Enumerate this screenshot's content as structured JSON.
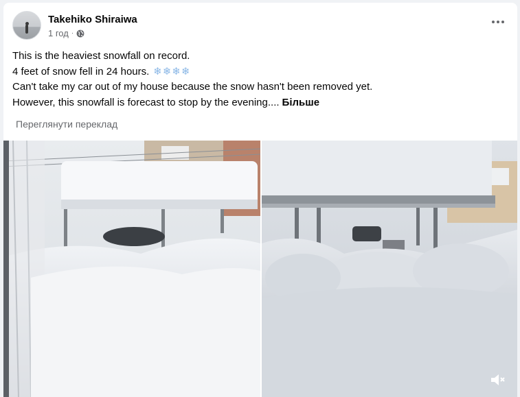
{
  "post": {
    "author": "Takehiko Shiraiwa",
    "time": "1 год",
    "time_sep": "·",
    "privacy_icon": "globe-icon",
    "more_icon": "more-options-icon",
    "lines": [
      "This is the heaviest snowfall on record.",
      "4 feet of snow fell in 24 hours.",
      "Can't take my car out of my house because the snow hasn't been removed yet.",
      "However, this snowfall is forecast to stop by the evening...."
    ],
    "snow_emojis": "❄❄❄❄",
    "see_more": "Більше",
    "translate_label": "Переглянути переклад"
  },
  "media": {
    "photos": [
      {
        "description_icon": "photo-snow-balcony"
      },
      {
        "description_icon": "video-snow-carport"
      }
    ],
    "mute_icon": "volume-muted-icon"
  },
  "colors": {
    "text_primary": "#050505",
    "text_secondary": "#65676b",
    "snow_emoji": "#8ab7e6",
    "page_background": "#f0f2f5"
  }
}
